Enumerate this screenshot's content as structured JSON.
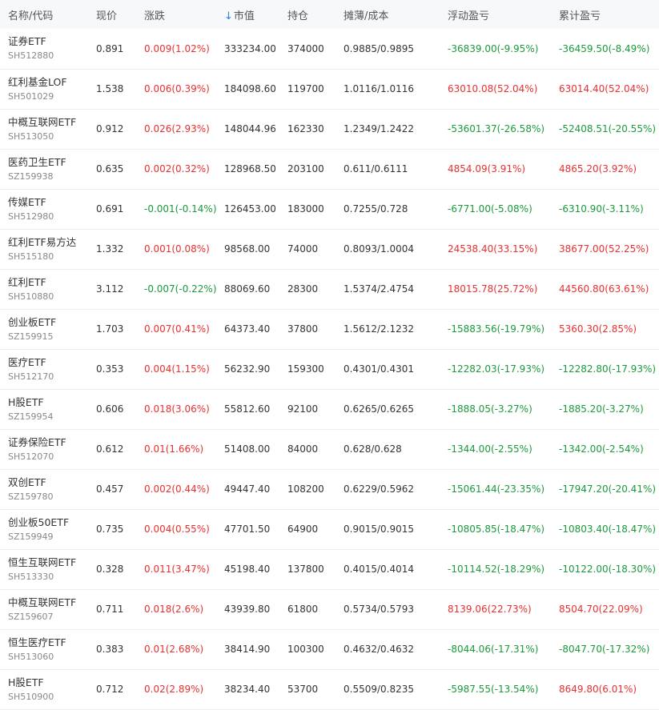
{
  "colors": {
    "up": "#e93030",
    "down": "#1b9a3c",
    "sort_arrow": "#2a7ee0",
    "header_bg": "#f7f8fa"
  },
  "header": {
    "name_code": "名称/代码",
    "price": "现价",
    "change": "涨跌",
    "sort_arrow_icon": "arrow-down-icon",
    "market_value": "市值",
    "holding": "持仓",
    "cost": "摊薄/成本",
    "float_pl": "浮动盈亏",
    "total_pl": "累计盈亏"
  },
  "rows": [
    {
      "name": "证券ETF",
      "code": "SH512880",
      "price": "0.891",
      "change": "0.009(1.02%)",
      "change_dir": "up",
      "market_value": "333234.00",
      "holding": "374000",
      "cost": "0.9885/0.9895",
      "float_pl": "-36839.00(-9.95%)",
      "float_dir": "down",
      "total_pl": "-36459.50(-8.49%)",
      "total_dir": "down"
    },
    {
      "name": "红利基金LOF",
      "code": "SH501029",
      "price": "1.538",
      "change": "0.006(0.39%)",
      "change_dir": "up",
      "market_value": "184098.60",
      "holding": "119700",
      "cost": "1.0116/1.0116",
      "float_pl": "63010.08(52.04%)",
      "float_dir": "up",
      "total_pl": "63014.40(52.04%)",
      "total_dir": "up"
    },
    {
      "name": "中概互联网ETF",
      "code": "SH513050",
      "price": "0.912",
      "change": "0.026(2.93%)",
      "change_dir": "up",
      "market_value": "148044.96",
      "holding": "162330",
      "cost": "1.2349/1.2422",
      "float_pl": "-53601.37(-26.58%)",
      "float_dir": "down",
      "total_pl": "-52408.51(-20.55%)",
      "total_dir": "down"
    },
    {
      "name": "医药卫生ETF",
      "code": "SZ159938",
      "price": "0.635",
      "change": "0.002(0.32%)",
      "change_dir": "up",
      "market_value": "128968.50",
      "holding": "203100",
      "cost": "0.611/0.6111",
      "float_pl": "4854.09(3.91%)",
      "float_dir": "up",
      "total_pl": "4865.20(3.92%)",
      "total_dir": "up"
    },
    {
      "name": "传媒ETF",
      "code": "SH512980",
      "price": "0.691",
      "change": "-0.001(-0.14%)",
      "change_dir": "down",
      "market_value": "126453.00",
      "holding": "183000",
      "cost": "0.7255/0.728",
      "float_pl": "-6771.00(-5.08%)",
      "float_dir": "down",
      "total_pl": "-6310.90(-3.11%)",
      "total_dir": "down"
    },
    {
      "name": "红利ETF易方达",
      "code": "SH515180",
      "price": "1.332",
      "change": "0.001(0.08%)",
      "change_dir": "up",
      "market_value": "98568.00",
      "holding": "74000",
      "cost": "0.8093/1.0004",
      "float_pl": "24538.40(33.15%)",
      "float_dir": "up",
      "total_pl": "38677.00(52.25%)",
      "total_dir": "up"
    },
    {
      "name": "红利ETF",
      "code": "SH510880",
      "price": "3.112",
      "change": "-0.007(-0.22%)",
      "change_dir": "down",
      "market_value": "88069.60",
      "holding": "28300",
      "cost": "1.5374/2.4754",
      "float_pl": "18015.78(25.72%)",
      "float_dir": "up",
      "total_pl": "44560.80(63.61%)",
      "total_dir": "up"
    },
    {
      "name": "创业板ETF",
      "code": "SZ159915",
      "price": "1.703",
      "change": "0.007(0.41%)",
      "change_dir": "up",
      "market_value": "64373.40",
      "holding": "37800",
      "cost": "1.5612/2.1232",
      "float_pl": "-15883.56(-19.79%)",
      "float_dir": "down",
      "total_pl": "5360.30(2.85%)",
      "total_dir": "up"
    },
    {
      "name": "医疗ETF",
      "code": "SH512170",
      "price": "0.353",
      "change": "0.004(1.15%)",
      "change_dir": "up",
      "market_value": "56232.90",
      "holding": "159300",
      "cost": "0.4301/0.4301",
      "float_pl": "-12282.03(-17.93%)",
      "float_dir": "down",
      "total_pl": "-12282.80(-17.93%)",
      "total_dir": "down"
    },
    {
      "name": "H股ETF",
      "code": "SZ159954",
      "price": "0.606",
      "change": "0.018(3.06%)",
      "change_dir": "up",
      "market_value": "55812.60",
      "holding": "92100",
      "cost": "0.6265/0.6265",
      "float_pl": "-1888.05(-3.27%)",
      "float_dir": "down",
      "total_pl": "-1885.20(-3.27%)",
      "total_dir": "down"
    },
    {
      "name": "证券保险ETF",
      "code": "SH512070",
      "price": "0.612",
      "change": "0.01(1.66%)",
      "change_dir": "up",
      "market_value": "51408.00",
      "holding": "84000",
      "cost": "0.628/0.628",
      "float_pl": "-1344.00(-2.55%)",
      "float_dir": "down",
      "total_pl": "-1342.00(-2.54%)",
      "total_dir": "down"
    },
    {
      "name": "双创ETF",
      "code": "SZ159780",
      "price": "0.457",
      "change": "0.002(0.44%)",
      "change_dir": "up",
      "market_value": "49447.40",
      "holding": "108200",
      "cost": "0.6229/0.5962",
      "float_pl": "-15061.44(-23.35%)",
      "float_dir": "down",
      "total_pl": "-17947.20(-20.41%)",
      "total_dir": "down"
    },
    {
      "name": "创业板50ETF",
      "code": "SZ159949",
      "price": "0.735",
      "change": "0.004(0.55%)",
      "change_dir": "up",
      "market_value": "47701.50",
      "holding": "64900",
      "cost": "0.9015/0.9015",
      "float_pl": "-10805.85(-18.47%)",
      "float_dir": "down",
      "total_pl": "-10803.40(-18.47%)",
      "total_dir": "down"
    },
    {
      "name": "恒生互联网ETF",
      "code": "SH513330",
      "price": "0.328",
      "change": "0.011(3.47%)",
      "change_dir": "up",
      "market_value": "45198.40",
      "holding": "137800",
      "cost": "0.4015/0.4014",
      "float_pl": "-10114.52(-18.29%)",
      "float_dir": "down",
      "total_pl": "-10122.00(-18.30%)",
      "total_dir": "down"
    },
    {
      "name": "中概互联网ETF",
      "code": "SZ159607",
      "price": "0.711",
      "change": "0.018(2.6%)",
      "change_dir": "up",
      "market_value": "43939.80",
      "holding": "61800",
      "cost": "0.5734/0.5793",
      "float_pl": "8139.06(22.73%)",
      "float_dir": "up",
      "total_pl": "8504.70(22.09%)",
      "total_dir": "up"
    },
    {
      "name": "恒生医疗ETF",
      "code": "SH513060",
      "price": "0.383",
      "change": "0.01(2.68%)",
      "change_dir": "up",
      "market_value": "38414.90",
      "holding": "100300",
      "cost": "0.4632/0.4632",
      "float_pl": "-8044.06(-17.31%)",
      "float_dir": "down",
      "total_pl": "-8047.70(-17.32%)",
      "total_dir": "down"
    },
    {
      "name": "H股ETF",
      "code": "SH510900",
      "price": "0.712",
      "change": "0.02(2.89%)",
      "change_dir": "up",
      "market_value": "38234.40",
      "holding": "53700",
      "cost": "0.5509/0.8235",
      "float_pl": "-5987.55(-13.54%)",
      "float_dir": "down",
      "total_pl": "8649.80(6.01%)",
      "total_dir": "up"
    }
  ]
}
